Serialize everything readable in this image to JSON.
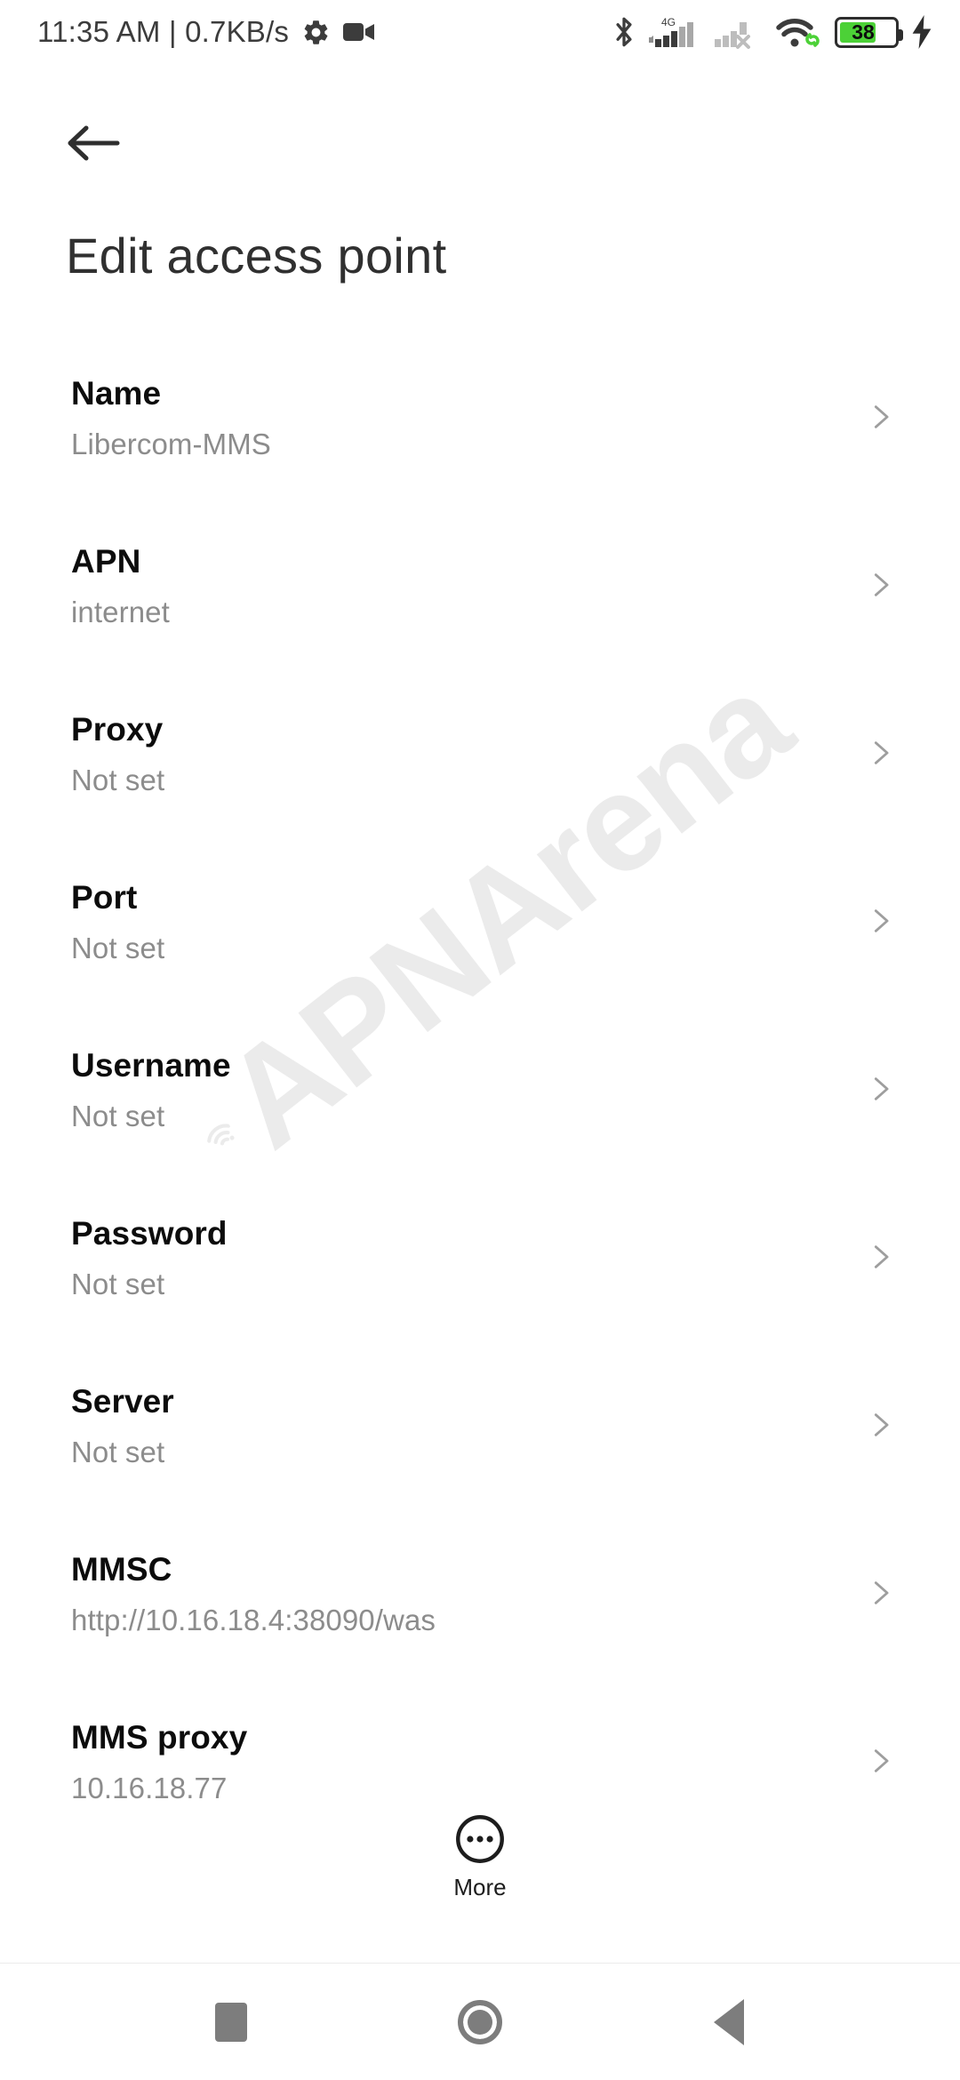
{
  "status_bar": {
    "clock": "11:35 AM | 0.7KB/s",
    "icons_left": [
      "gear-icon",
      "video-recorder-icon"
    ],
    "icons_right": [
      "bluetooth-icon",
      "signal-4g-icon",
      "signal-no-service-icon",
      "wifi-icon",
      "battery-icon",
      "charging-bolt-icon"
    ],
    "network_type": "4G",
    "battery_level": "38",
    "battery_color": "#4cd137"
  },
  "app_bar": {
    "back_label": "back",
    "title": "Edit access point"
  },
  "watermark": {
    "text": "APNArena"
  },
  "settings": {
    "rows": [
      {
        "label": "Name",
        "value": "Libercom-MMS"
      },
      {
        "label": "APN",
        "value": "internet"
      },
      {
        "label": "Proxy",
        "value": "Not set"
      },
      {
        "label": "Port",
        "value": "Not set"
      },
      {
        "label": "Username",
        "value": "Not set"
      },
      {
        "label": "Password",
        "value": "Not set"
      },
      {
        "label": "Server",
        "value": "Not set"
      },
      {
        "label": "MMSC",
        "value": "http://10.16.18.4:38090/was"
      },
      {
        "label": "MMS proxy",
        "value": "10.16.18.77"
      }
    ]
  },
  "more_button": {
    "label": "More"
  },
  "nav_bar": {
    "recents_label": "Recents",
    "home_label": "Home",
    "back_label": "Back"
  }
}
